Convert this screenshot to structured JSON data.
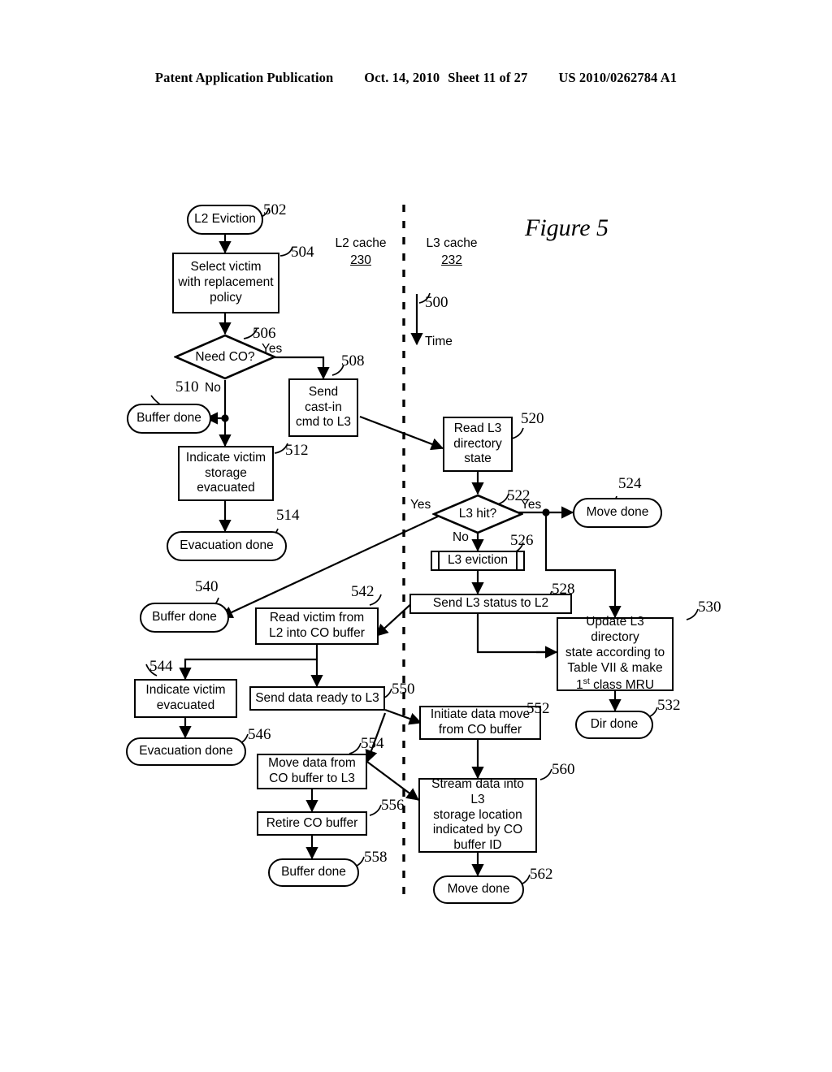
{
  "header": {
    "publication": "Patent Application Publication",
    "date": "Oct. 14, 2010",
    "sheet": "Sheet 11 of 27",
    "patent_number": "US 2010/0262784 A1"
  },
  "figure": {
    "title": "Figure 5"
  },
  "columns": {
    "left": {
      "name": "L2 cache",
      "ref": "230"
    },
    "right": {
      "name": "L3 cache",
      "ref": "232"
    }
  },
  "time_axis": {
    "ref": "500",
    "label": "Time"
  },
  "nodes": [
    {
      "id": "502",
      "ref": "502",
      "label": "L2 Eviction",
      "shape": "terminator"
    },
    {
      "id": "504",
      "ref": "504",
      "label": "Select victim with replacement policy",
      "shape": "process"
    },
    {
      "id": "506",
      "ref": "506",
      "label": "Need CO?",
      "shape": "decision"
    },
    {
      "id": "508",
      "ref": "508",
      "label": "Send cast-in cmd to L3",
      "shape": "process"
    },
    {
      "id": "510",
      "ref": "510",
      "label": "Buffer done",
      "shape": "terminator"
    },
    {
      "id": "512",
      "ref": "512",
      "label": "Indicate victim storage evacuated",
      "shape": "process"
    },
    {
      "id": "514",
      "ref": "514",
      "label": "Evacuation done",
      "shape": "terminator"
    },
    {
      "id": "520",
      "ref": "520",
      "label": "Read L3 directory state",
      "shape": "process"
    },
    {
      "id": "522",
      "ref": "522",
      "label": "L3 hit?",
      "shape": "decision"
    },
    {
      "id": "524",
      "ref": "524",
      "label": "Move done",
      "shape": "terminator"
    },
    {
      "id": "526",
      "ref": "526",
      "label": "L3 eviction",
      "shape": "subroutine"
    },
    {
      "id": "528",
      "ref": "528",
      "label": "Send L3 status to L2",
      "shape": "process"
    },
    {
      "id": "530",
      "ref": "530",
      "label": "Update L3 directory state according to Table VII & make 1st class MRU",
      "shape": "process"
    },
    {
      "id": "532",
      "ref": "532",
      "label": "Dir done",
      "shape": "terminator"
    },
    {
      "id": "540",
      "ref": "540",
      "label": "Buffer done",
      "shape": "terminator"
    },
    {
      "id": "542",
      "ref": "542",
      "label": "Read victim from L2 into CO buffer",
      "shape": "process"
    },
    {
      "id": "544",
      "ref": "544",
      "label": "Indicate victim evacuated",
      "shape": "process"
    },
    {
      "id": "546",
      "ref": "546",
      "label": "Evacuation done",
      "shape": "terminator"
    },
    {
      "id": "550",
      "ref": "550",
      "label": "Send data ready to L3",
      "shape": "process"
    },
    {
      "id": "552",
      "ref": "552",
      "label": "Initiate data move from CO buffer",
      "shape": "process"
    },
    {
      "id": "554",
      "ref": "554",
      "label": "Move data from CO buffer to L3",
      "shape": "process"
    },
    {
      "id": "556",
      "ref": "556",
      "label": "Retire CO buffer",
      "shape": "process"
    },
    {
      "id": "558",
      "ref": "558",
      "label": "Buffer done",
      "shape": "terminator"
    },
    {
      "id": "560",
      "ref": "560",
      "label": "Stream data into L3 storage location indicated by CO buffer ID",
      "shape": "process"
    },
    {
      "id": "562",
      "ref": "562",
      "label": "Move done",
      "shape": "terminator"
    }
  ],
  "edge_labels": {
    "need_co_yes": "Yes",
    "need_co_no": "No",
    "l3_hit_yes_right": "Yes",
    "l3_hit_yes_left": "Yes",
    "l3_hit_no": "No"
  },
  "node_text": {
    "n502": "L2 Eviction",
    "n504_l1": "Select victim",
    "n504_l2": "with replacement",
    "n504_l3": "policy",
    "n506": "Need CO?",
    "n508_l1": "Send",
    "n508_l2": "cast-in",
    "n508_l3": "cmd to L3",
    "n510": "Buffer done",
    "n512_l1": "Indicate victim",
    "n512_l2": "storage",
    "n512_l3": "evacuated",
    "n514": "Evacuation done",
    "n520_l1": "Read L3",
    "n520_l2": "directory",
    "n520_l3": "state",
    "n522": "L3 hit?",
    "n524": "Move done",
    "n526": "L3 eviction",
    "n528": "Send L3 status to L2",
    "n530_l1": "Update L3 directory",
    "n530_l2": "state according to",
    "n530_l3": "Table VII & make",
    "n530_l4a": "1",
    "n530_l4b": "st",
    "n530_l4c": " class MRU",
    "n532": "Dir done",
    "n540": "Buffer done",
    "n542_l1": "Read victim from",
    "n542_l2": "L2 into CO buffer",
    "n544_l1": "Indicate victim",
    "n544_l2": "evacuated",
    "n546": "Evacuation done",
    "n550": "Send data ready to L3",
    "n552_l1": "Initiate data move",
    "n552_l2": "from CO buffer",
    "n554_l1": "Move data from",
    "n554_l2": "CO buffer to L3",
    "n556": "Retire CO buffer",
    "n558": "Buffer done",
    "n560_l1": "Stream data into L3",
    "n560_l2": "storage location",
    "n560_l3": "indicated by CO",
    "n560_l4": "buffer ID",
    "n562": "Move done"
  },
  "refs": {
    "r502": "502",
    "r504": "504",
    "r506": "506",
    "r508": "508",
    "r510": "510",
    "r512": "512",
    "r514": "514",
    "r520": "520",
    "r522": "522",
    "r524": "524",
    "r526": "526",
    "r528": "528",
    "r530": "530",
    "r532": "532",
    "r540": "540",
    "r542": "542",
    "r544": "544",
    "r546": "546",
    "r550": "550",
    "r552": "552",
    "r554": "554",
    "r556": "556",
    "r558": "558",
    "r560": "560",
    "r562": "562",
    "r500": "500"
  },
  "colors": {
    "ink": "#000000",
    "paper": "#ffffff"
  }
}
